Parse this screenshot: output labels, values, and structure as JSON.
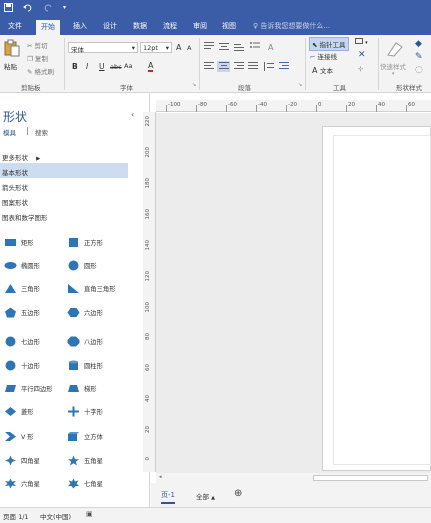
{
  "quick_access": {
    "save_icon": "save-icon",
    "undo_icon": "undo-icon",
    "redo_icon": "redo-icon",
    "customize_icon": "chevron-down-icon"
  },
  "tabs": [
    "文件",
    "开始",
    "插入",
    "设计",
    "数据",
    "流程",
    "审阅",
    "视图"
  ],
  "tell_me": "告诉我您想要做什么...",
  "ribbon": {
    "clipboard": {
      "paste": "粘贴",
      "cut": "剪切",
      "copy": "复制",
      "format_painter": "格式刷",
      "label": "剪贴板"
    },
    "font": {
      "name": "宋体",
      "size": "12pt",
      "grow": "A",
      "shrink": "A",
      "bold": "B",
      "italic": "I",
      "underline": "U",
      "strike": "abc",
      "case": "Aa",
      "color": "A",
      "label": "字体"
    },
    "paragraph": {
      "label": "段落"
    },
    "tools": {
      "pointer": "指针工具",
      "connector": "连接线",
      "text": "文本",
      "label": "工具"
    },
    "shape_styles": {
      "quick_styles": "快速样式",
      "label": "形状样式"
    }
  },
  "sidebar": {
    "title": "形状",
    "tabs": [
      "模具",
      "搜索"
    ],
    "more_shapes": "更多形状",
    "categories": [
      "基本形状",
      "箭头形状",
      "图案形状",
      "图表和数学图形"
    ],
    "shapes": [
      [
        "矩形",
        "正方形"
      ],
      [
        "椭圆形",
        "圆形"
      ],
      [
        "三角形",
        "直角三角形"
      ],
      [
        "五边形",
        "六边形"
      ],
      [
        "七边形",
        "八边形"
      ],
      [
        "十边形",
        "圆柱形"
      ],
      [
        "平行四边形",
        "梯形"
      ],
      [
        "菱形",
        "十字形"
      ],
      [
        "V 形",
        "立方体"
      ],
      [
        "四角星",
        "五角星"
      ],
      [
        "六角星",
        "七角星"
      ]
    ]
  },
  "rulers": {
    "h": [
      "-100",
      "-80",
      "-60",
      "-40",
      "-20",
      "0",
      "20",
      "40",
      "60"
    ],
    "v": [
      "220",
      "200",
      "180",
      "160",
      "140",
      "120",
      "100",
      "80",
      "60",
      "40",
      "20",
      "0"
    ]
  },
  "page_tabs": {
    "current": "页-1",
    "all": "全部",
    "add_icon": "plus-circle-icon"
  },
  "status": {
    "page": "页面 1/1",
    "language": "中文(中国)"
  },
  "colors": {
    "brand": "#3B5CA6",
    "accent": "#2B579A",
    "shape_fill": "#2E75B6",
    "selected": "#CDDCF0"
  }
}
